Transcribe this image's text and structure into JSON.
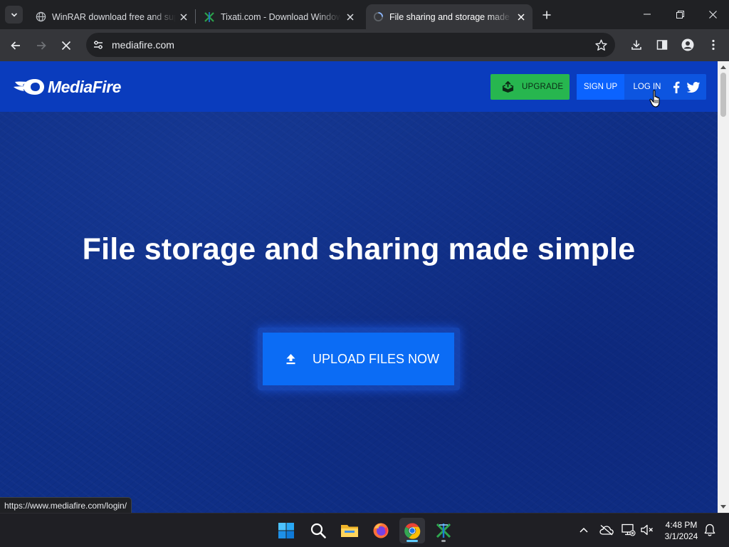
{
  "browser": {
    "tabs": [
      {
        "title": "WinRAR download free and support: WinRAR",
        "active": false,
        "favicon": "globe-icon"
      },
      {
        "title": "Tixati.com - Download Windows",
        "active": false,
        "favicon": "tixati-icon"
      },
      {
        "title": "File sharing and storage made simple",
        "active": true,
        "favicon": "loading-spinner-icon"
      }
    ],
    "address": "mediafire.com",
    "colors": {
      "frame": "#202124",
      "toolbar": "#35363a"
    }
  },
  "page": {
    "logo_text": "MediaFire",
    "header": {
      "upgrade_label": "UPGRADE",
      "signup_label": "SIGN UP",
      "login_label": "LOG IN"
    },
    "hero_title": "File storage and sharing made simple",
    "upload_label": "UPLOAD FILES NOW",
    "colors": {
      "header": "#0a3cbd",
      "hero": "#0f2f87",
      "upgrade": "#27b64f",
      "primary": "#0b6cf5"
    }
  },
  "status_bar": {
    "url": "https://www.mediafire.com/login/"
  },
  "taskbar": {
    "apps": [
      "start-icon",
      "search-icon",
      "file-explorer-icon",
      "firefox-icon",
      "chrome-icon",
      "tixati-icon"
    ],
    "clock_time": "4:48 PM",
    "clock_date": "3/1/2024"
  }
}
